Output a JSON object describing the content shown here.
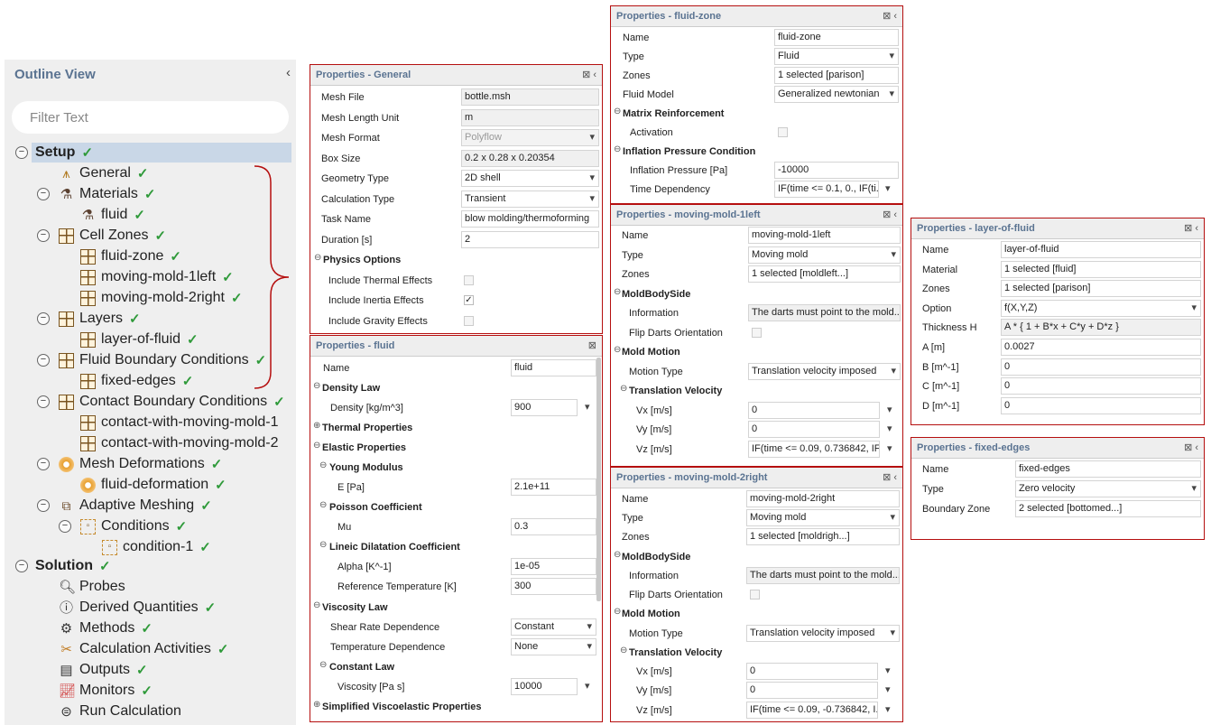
{
  "outline": {
    "title": "Outline View",
    "collapse": "‹",
    "filter_placeholder": "Filter Text",
    "items": [
      {
        "label": "Setup"
      },
      {
        "label": "General"
      },
      {
        "label": "Materials"
      },
      {
        "label": "fluid"
      },
      {
        "label": "Cell Zones"
      },
      {
        "label": "fluid-zone"
      },
      {
        "label": "moving-mold-1left"
      },
      {
        "label": "moving-mold-2right"
      },
      {
        "label": "Layers"
      },
      {
        "label": "layer-of-fluid"
      },
      {
        "label": "Fluid Boundary Conditions"
      },
      {
        "label": "fixed-edges"
      },
      {
        "label": "Contact Boundary Conditions"
      },
      {
        "label": "contact-with-moving-mold-1"
      },
      {
        "label": "contact-with-moving-mold-2"
      },
      {
        "label": "Mesh Deformations"
      },
      {
        "label": "fluid-deformation"
      },
      {
        "label": "Adaptive Meshing"
      },
      {
        "label": "Conditions"
      },
      {
        "label": "condition-1"
      },
      {
        "label": "Solution"
      },
      {
        "label": "Probes"
      },
      {
        "label": "Derived Quantities"
      },
      {
        "label": "Methods"
      },
      {
        "label": "Calculation Activities"
      },
      {
        "label": "Outputs"
      },
      {
        "label": "Monitors"
      },
      {
        "label": "Run Calculation"
      }
    ]
  },
  "general": {
    "title": "Properties - General",
    "rows": [
      {
        "label": "Mesh File",
        "value": "bottle.msh"
      },
      {
        "label": "Mesh Length Unit",
        "value": "m"
      },
      {
        "label": "Mesh Format",
        "value": "Polyflow"
      },
      {
        "label": "Box Size",
        "value": "0.2 x 0.28 x 0.20354"
      },
      {
        "label": "Geometry Type",
        "value": "2D shell"
      },
      {
        "label": "Calculation Type",
        "value": "Transient"
      },
      {
        "label": "Task Name",
        "value": "blow molding/thermoforming"
      },
      {
        "label": "Duration [s]",
        "value": "2"
      },
      {
        "label": "Physics Options"
      },
      {
        "label": "Include Thermal Effects"
      },
      {
        "label": "Include Inertia Effects",
        "value": "✓"
      },
      {
        "label": "Include Gravity Effects"
      }
    ]
  },
  "fluid": {
    "title": "Properties - fluid",
    "rows": [
      {
        "label": "Name",
        "value": "fluid"
      },
      {
        "label": "Density Law"
      },
      {
        "label": "Density [kg/m^3]",
        "value": "900"
      },
      {
        "label": "Thermal Properties"
      },
      {
        "label": "Elastic Properties"
      },
      {
        "label": "Young Modulus"
      },
      {
        "label": "E [Pa]",
        "value": "2.1e+11"
      },
      {
        "label": "Poisson Coefficient"
      },
      {
        "label": "Mu",
        "value": "0.3"
      },
      {
        "label": "Lineic Dilatation Coefficient"
      },
      {
        "label": "Alpha [K^-1]",
        "value": "1e-05"
      },
      {
        "label": "Reference Temperature [K]",
        "value": "300"
      },
      {
        "label": "Viscosity Law"
      },
      {
        "label": "Shear Rate Dependence",
        "value": "Constant"
      },
      {
        "label": "Temperature Dependence",
        "value": "None"
      },
      {
        "label": "Constant Law"
      },
      {
        "label": "Viscosity [Pa s]",
        "value": "10000"
      },
      {
        "label": "Simplified Viscoelastic Properties"
      }
    ]
  },
  "fluidzone": {
    "title": "Properties - fluid-zone",
    "rows": [
      {
        "label": "Name",
        "value": "fluid-zone"
      },
      {
        "label": "Type",
        "value": "Fluid"
      },
      {
        "label": "Zones",
        "value": "1 selected [parison]"
      },
      {
        "label": "Fluid Model",
        "value": "Generalized newtonian"
      },
      {
        "label": "Matrix Reinforcement"
      },
      {
        "label": "Activation"
      },
      {
        "label": "Inflation Pressure Condition"
      },
      {
        "label": "Inflation Pressure [Pa]",
        "value": "-10000"
      },
      {
        "label": "Time Dependency",
        "value": "IF(time <= 0.1, 0., IF(ti..."
      }
    ]
  },
  "mold1": {
    "title": "Properties - moving-mold-1left",
    "rows": [
      {
        "label": "Name",
        "value": "moving-mold-1left"
      },
      {
        "label": "Type",
        "value": "Moving mold"
      },
      {
        "label": "Zones",
        "value": "1 selected [moldleft...]"
      },
      {
        "label": "MoldBodySide"
      },
      {
        "label": "Information",
        "value": "The darts must point to the mold..."
      },
      {
        "label": "Flip Darts Orientation"
      },
      {
        "label": "Mold Motion"
      },
      {
        "label": "Motion Type",
        "value": "Translation velocity imposed"
      },
      {
        "label": "Translation Velocity"
      },
      {
        "label": "Vx [m/s]",
        "value": "0"
      },
      {
        "label": "Vy [m/s]",
        "value": "0"
      },
      {
        "label": "Vz [m/s]",
        "value": "IF(time <= 0.09, 0.736842, IF..."
      }
    ]
  },
  "mold2": {
    "title": "Properties - moving-mold-2right",
    "rows": [
      {
        "label": "Name",
        "value": "moving-mold-2right"
      },
      {
        "label": "Type",
        "value": "Moving mold"
      },
      {
        "label": "Zones",
        "value": "1 selected [moldrigh...]"
      },
      {
        "label": "MoldBodySide"
      },
      {
        "label": "Information",
        "value": "The darts must point to the mold..."
      },
      {
        "label": "Flip Darts Orientation"
      },
      {
        "label": "Mold Motion"
      },
      {
        "label": "Motion Type",
        "value": "Translation velocity imposed"
      },
      {
        "label": "Translation Velocity"
      },
      {
        "label": "Vx [m/s]",
        "value": "0"
      },
      {
        "label": "Vy [m/s]",
        "value": "0"
      },
      {
        "label": "Vz [m/s]",
        "value": "IF(time <= 0.09, -0.736842, I..."
      }
    ]
  },
  "layer": {
    "title": "Properties - layer-of-fluid",
    "rows": [
      {
        "label": "Name",
        "value": "layer-of-fluid"
      },
      {
        "label": "Material",
        "value": "1 selected [fluid]"
      },
      {
        "label": "Zones",
        "value": "1 selected [parison]"
      },
      {
        "label": "Option",
        "value": "f(X,Y,Z)"
      },
      {
        "label": "Thickness H",
        "value": "A * { 1 + B*x + C*y + D*z }"
      },
      {
        "label": "A [m]",
        "value": "0.0027"
      },
      {
        "label": "B [m^-1]",
        "value": "0"
      },
      {
        "label": "C [m^-1]",
        "value": "0"
      },
      {
        "label": "D [m^-1]",
        "value": "0"
      }
    ]
  },
  "edges": {
    "title": "Properties - fixed-edges",
    "rows": [
      {
        "label": "Name",
        "value": "fixed-edges"
      },
      {
        "label": "Type",
        "value": "Zero velocity"
      },
      {
        "label": "Boundary Zone",
        "value": "2 selected [bottomed...]"
      }
    ]
  },
  "panel_tools": "⊠ ‹",
  "colors": {
    "check": "#2f9a3a",
    "panel_border": "#b50f0f",
    "title_blue": "#5a7391",
    "selection": "#c9d7e7"
  }
}
